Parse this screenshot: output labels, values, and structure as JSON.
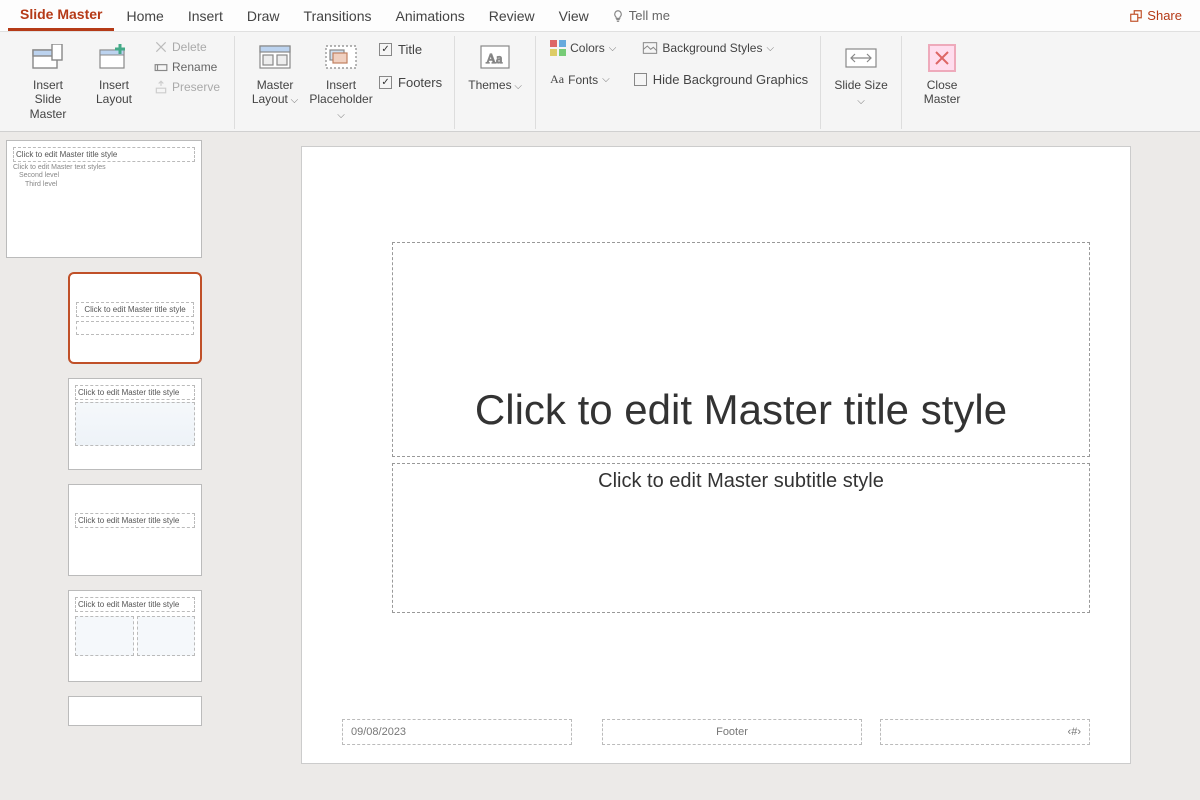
{
  "tabs": {
    "slide_master": "Slide Master",
    "home": "Home",
    "insert": "Insert",
    "draw": "Draw",
    "transitions": "Transitions",
    "animations": "Animations",
    "review": "Review",
    "view": "View",
    "tell_me": "Tell me",
    "share": "Share"
  },
  "ribbon": {
    "insert_slide_master": "Insert Slide Master",
    "insert_layout": "Insert Layout",
    "delete": "Delete",
    "rename": "Rename",
    "preserve": "Preserve",
    "master_layout": "Master Layout",
    "insert_placeholder": "Insert Placeholder",
    "title": "Title",
    "footers": "Footers",
    "themes": "Themes",
    "colors": "Colors",
    "fonts": "Fonts",
    "background_styles": "Background Styles",
    "hide_bg": "Hide Background Graphics",
    "slide_size": "Slide Size",
    "close_master": "Close Master"
  },
  "thumbs": {
    "master": "Click to edit Master title style",
    "text_styles": "Click to edit Master text styles",
    "second": "Second level",
    "third": "Third level"
  },
  "slide": {
    "title": "Click to edit Master title style",
    "subtitle": "Click to edit Master subtitle style",
    "date": "09/08/2023",
    "footer": "Footer",
    "num": "‹#›"
  }
}
